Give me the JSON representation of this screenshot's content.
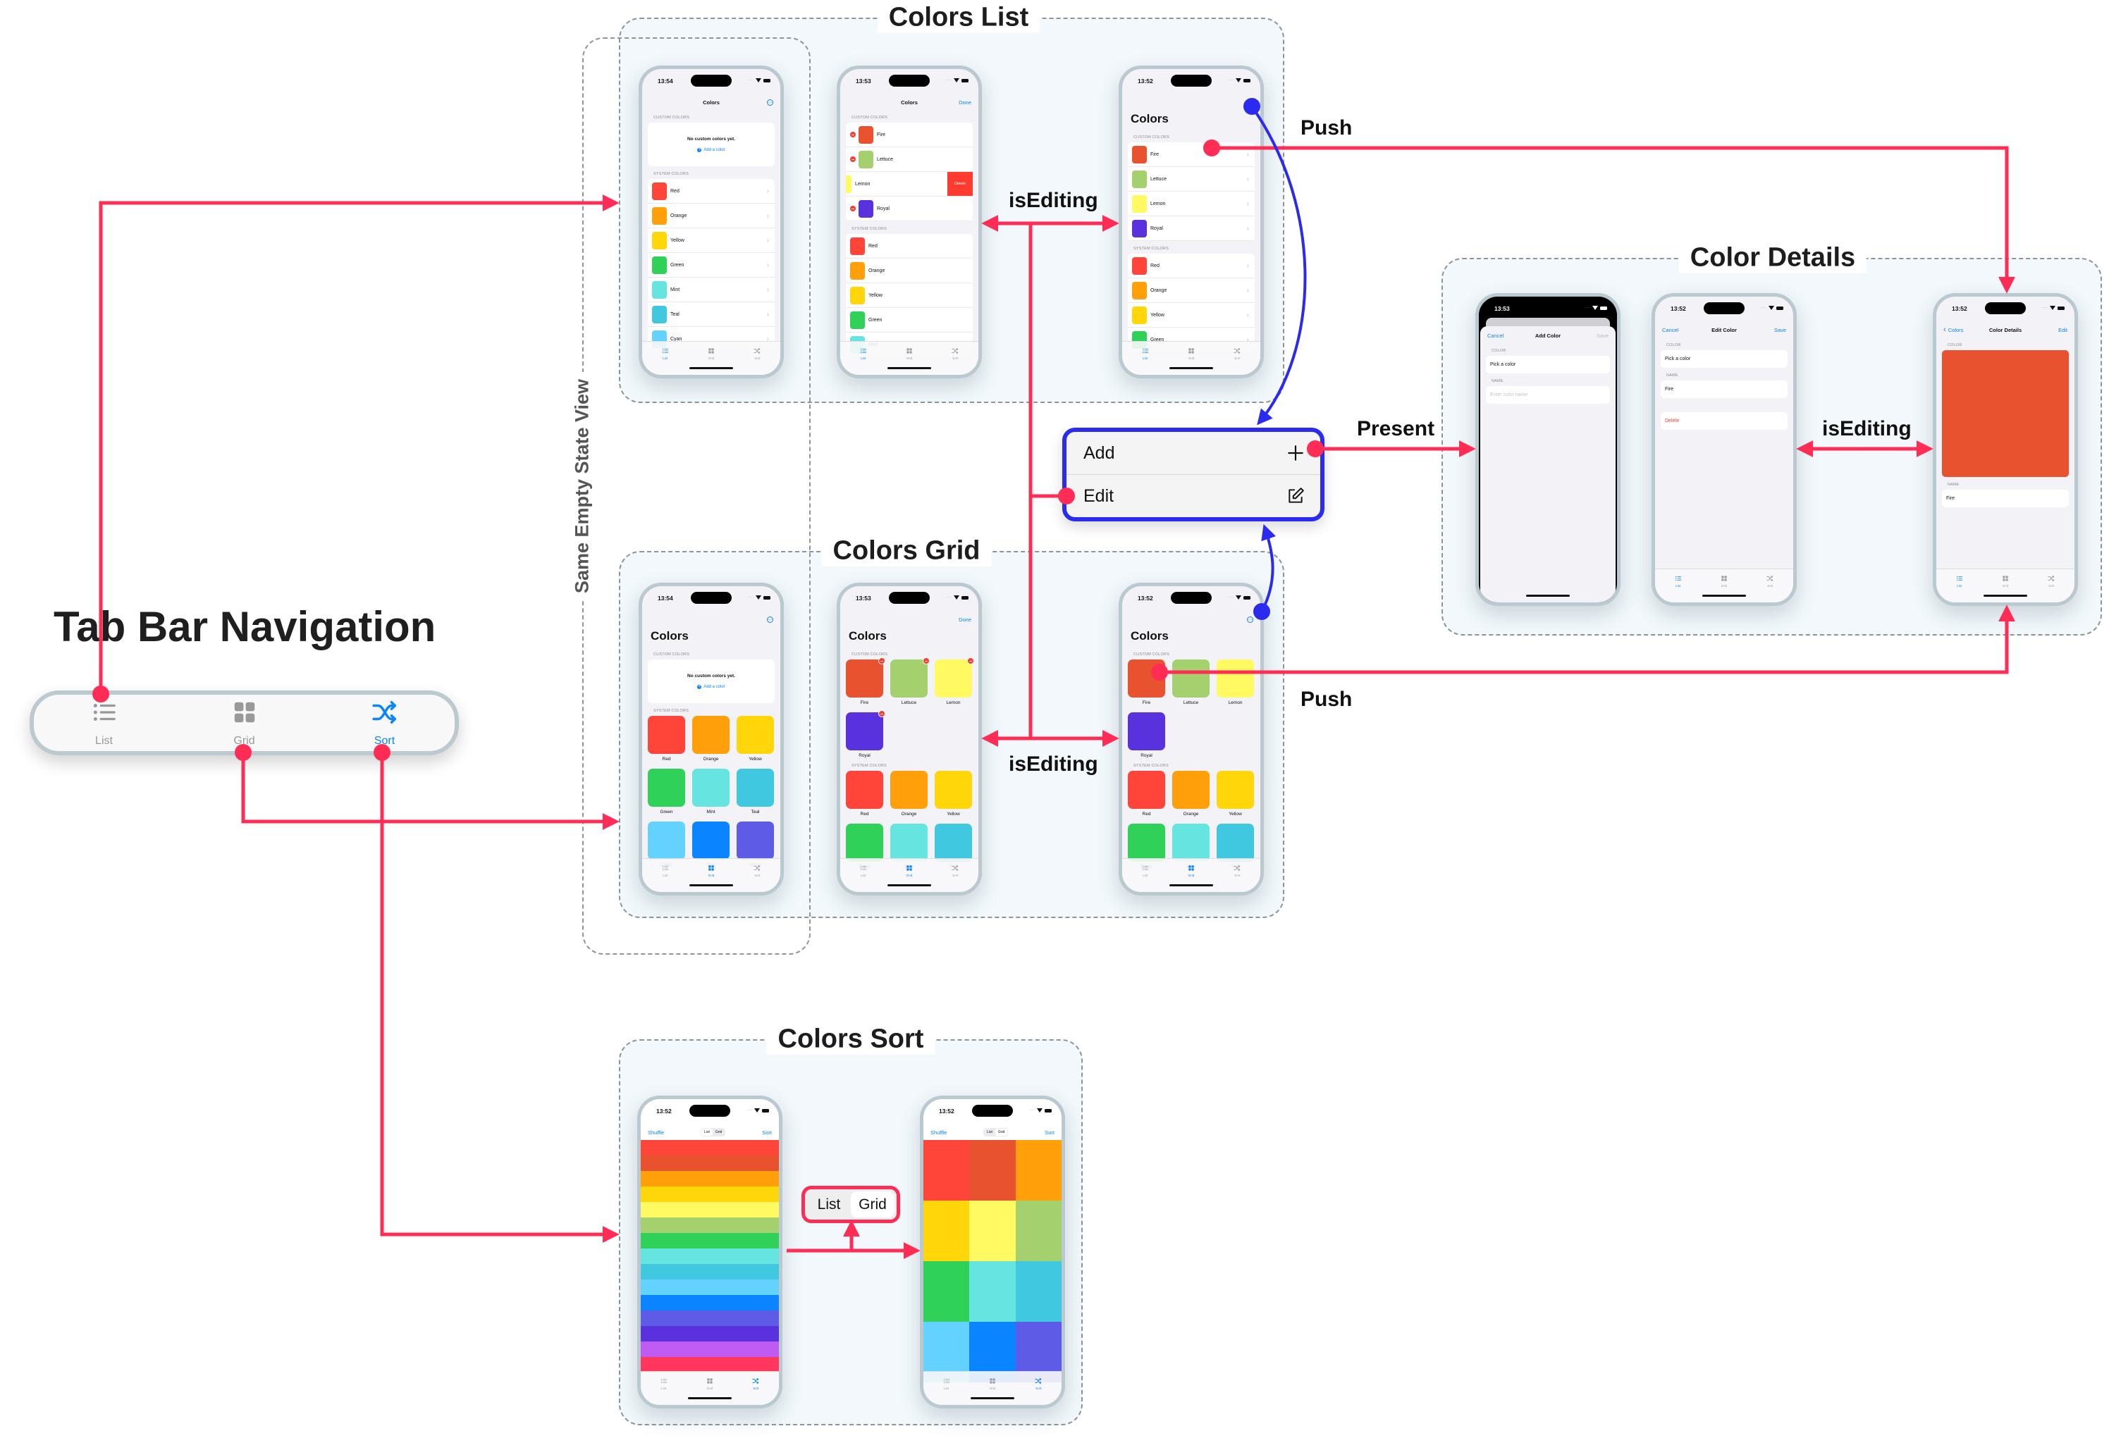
{
  "diagram": {
    "title": "Tab Bar Navigation",
    "empty_state_label": "Same Empty State View",
    "sections": {
      "list": "Colors List",
      "grid": "Colors Grid",
      "sort": "Colors Sort",
      "details": "Color Details"
    },
    "edge_labels": {
      "push_list": "Push",
      "push_grid": "Push",
      "editing_list": "isEditing",
      "editing_grid": "isEditing",
      "present": "Present",
      "editing_details": "isEditing"
    },
    "menu": {
      "items": [
        {
          "label": "Add",
          "icon": "plus-icon"
        },
        {
          "label": "Edit",
          "icon": "square-pencil-icon"
        }
      ]
    },
    "tab_bar": {
      "items": [
        {
          "label": "List",
          "icon": "list-bullet-icon"
        },
        {
          "label": "Grid",
          "icon": "grid-icon"
        },
        {
          "label": "Sort",
          "icon": "shuffle-icon",
          "active": true
        }
      ]
    },
    "segmented": {
      "options": [
        "List",
        "Grid"
      ],
      "selected": "Grid"
    },
    "accent": {
      "connector": "#FF2D55",
      "menu_connector": "#2B2BF0",
      "ios_blue": "#0A84FF"
    }
  },
  "color_values": {
    "Red": "#FF453A",
    "Orange": "#FF9F0A",
    "Yellow": "#FFD60A",
    "Green": "#30D158",
    "Mint": "#66E4E0",
    "Teal": "#40C8E0",
    "Cyan": "#64D2FF",
    "Blue": "#0A84FF",
    "Indigo": "#5E5CE6",
    "Purple": "#BF5AF2",
    "Pink": "#FF375F",
    "Fire": "#E9522F",
    "Lettuce": "#A4D16E",
    "Lemon": "#FFF962",
    "Royal": "#5932DE",
    "Picker": "#FF0000"
  },
  "phone_tab_labels": [
    "List",
    "Grid",
    "Sort"
  ],
  "phones": {
    "list_empty": {
      "time": "13:54",
      "nav": {
        "title": "Colors",
        "ellipsis": true
      },
      "tab_active": 0,
      "sections": [
        {
          "header": "Custom Colors",
          "empty": {
            "text": "No custom colors yet.",
            "add": "Add a color"
          }
        },
        {
          "header": "System Colors",
          "chevron": true,
          "rows": [
            {
              "name": "Red"
            },
            {
              "name": "Orange"
            },
            {
              "name": "Yellow"
            },
            {
              "name": "Green"
            },
            {
              "name": "Mint"
            },
            {
              "name": "Teal"
            },
            {
              "name": "Cyan"
            }
          ]
        }
      ]
    },
    "list_editing": {
      "time": "13:53",
      "nav": {
        "title": "Colors",
        "right": "Done"
      },
      "tab_active": 0,
      "sections": [
        {
          "header": "Custom Colors",
          "rows": [
            {
              "name": "Fire",
              "minus": true
            },
            {
              "name": "Lettuce",
              "minus": true
            },
            {
              "name": "Lemon",
              "swiped": true,
              "action": "Delete"
            },
            {
              "name": "Royal",
              "minus": true
            }
          ]
        },
        {
          "header": "System Colors",
          "rows": [
            {
              "name": "Red"
            },
            {
              "name": "Orange"
            },
            {
              "name": "Yellow"
            },
            {
              "name": "Green"
            },
            {
              "name": "Mint"
            }
          ]
        }
      ]
    },
    "list_normal": {
      "time": "13:52",
      "nav": {
        "ellipsis": true
      },
      "large_title": "Colors",
      "tab_active": 0,
      "sections": [
        {
          "header": "Custom Colors",
          "chevron": true,
          "rows": [
            {
              "name": "Fire"
            },
            {
              "name": "Lettuce"
            },
            {
              "name": "Lemon"
            },
            {
              "name": "Royal"
            }
          ]
        },
        {
          "header": "System Colors",
          "chevron": true,
          "rows": [
            {
              "name": "Red"
            },
            {
              "name": "Orange"
            },
            {
              "name": "Yellow"
            },
            {
              "name": "Green"
            }
          ]
        }
      ]
    },
    "grid_empty": {
      "time": "13:54",
      "nav": {
        "ellipsis": true
      },
      "large_title": "Colors",
      "tab_active": 1,
      "sections": [
        {
          "header": "Custom Colors",
          "empty": {
            "text": "No custom colors yet.",
            "add": "Add a color"
          }
        },
        {
          "header": "System Colors",
          "tiles": [
            {
              "name": "Red"
            },
            {
              "name": "Orange"
            },
            {
              "name": "Yellow"
            },
            {
              "name": "Green"
            },
            {
              "name": "Mint"
            },
            {
              "name": "Teal"
            },
            {
              "name": "Cyan"
            },
            {
              "name": "Blue"
            },
            {
              "name": "Indigo"
            }
          ]
        }
      ]
    },
    "grid_editing": {
      "time": "13:53",
      "nav": {
        "right": "Done"
      },
      "large_title": "Colors",
      "tab_active": 1,
      "sections": [
        {
          "header": "Custom Colors",
          "tiles": [
            {
              "name": "Fire",
              "minus": true
            },
            {
              "name": "Lettuce",
              "minus": true
            },
            {
              "name": "Lemon",
              "minus": true
            },
            {
              "name": "Royal",
              "minus": true
            }
          ]
        },
        {
          "header": "System Colors",
          "tiles": [
            {
              "name": "Red"
            },
            {
              "name": "Orange"
            },
            {
              "name": "Yellow"
            },
            {
              "name": "Green"
            },
            {
              "name": "Mint"
            },
            {
              "name": "Teal"
            }
          ]
        }
      ]
    },
    "grid_normal": {
      "time": "13:52",
      "nav": {
        "ellipsis": true
      },
      "large_title": "Colors",
      "tab_active": 1,
      "sections": [
        {
          "header": "Custom Colors",
          "tiles": [
            {
              "name": "Fire"
            },
            {
              "name": "Lettuce"
            },
            {
              "name": "Lemon"
            },
            {
              "name": "Royal"
            }
          ]
        },
        {
          "header": "System Colors",
          "tiles": [
            {
              "name": "Red"
            },
            {
              "name": "Orange"
            },
            {
              "name": "Yellow"
            },
            {
              "name": "Green"
            },
            {
              "name": "Mint"
            },
            {
              "name": "Teal"
            }
          ]
        }
      ]
    },
    "add_color": {
      "time": "13:53",
      "sheet": true,
      "nav": {
        "left": "Cancel",
        "title": "Add Color",
        "right": "Save",
        "right_disabled": true
      },
      "sections": [
        {
          "header": "Color",
          "field": {
            "text": "Pick a color",
            "swatch": "Picker"
          }
        },
        {
          "header": "Name",
          "field": {
            "placeholder": "Enter color name"
          }
        }
      ]
    },
    "edit_color": {
      "time": "13:52",
      "nav": {
        "left": "Cancel",
        "title": "Edit Color",
        "right": "Save"
      },
      "tab_active": 0,
      "sections": [
        {
          "header": "Color",
          "field": {
            "text": "Pick a color",
            "swatch": "Fire"
          }
        },
        {
          "header": "Name",
          "field": {
            "text": "Fire"
          }
        },
        {
          "field": {
            "text": "Delete",
            "destructive": true
          }
        }
      ]
    },
    "color_details": {
      "time": "13:52",
      "nav": {
        "left": "Colors",
        "back": true,
        "title": "Color Details",
        "right": "Edit"
      },
      "tab_active": 0,
      "sections": [
        {
          "header": "Color",
          "big_swatch": "Fire"
        },
        {
          "header": "Name",
          "field": {
            "text": "Fire"
          }
        }
      ]
    },
    "sort_list": {
      "time": "13:52",
      "sort_nav": {
        "left": "Shuffle",
        "segments": [
          "List",
          "Grid"
        ],
        "selected": 0,
        "right": "Sort"
      },
      "tab_active": 2,
      "stripes": [
        "Red",
        "Fire",
        "Orange",
        "Yellow",
        "Lemon",
        "Lettuce",
        "Green",
        "Mint",
        "Teal",
        "Cyan",
        "Blue",
        "Indigo",
        "Royal",
        "Purple",
        "Pink"
      ]
    },
    "sort_grid": {
      "time": "13:52",
      "sort_nav": {
        "left": "Shuffle",
        "segments": [
          "List",
          "Grid"
        ],
        "selected": 1,
        "right": "Sort"
      },
      "tab_active": 2,
      "cells": [
        "Red",
        "Fire",
        "Orange",
        "Yellow",
        "Lemon",
        "Lettuce",
        "Green",
        "Mint",
        "Teal",
        "Cyan",
        "Blue",
        "Indigo"
      ]
    }
  }
}
